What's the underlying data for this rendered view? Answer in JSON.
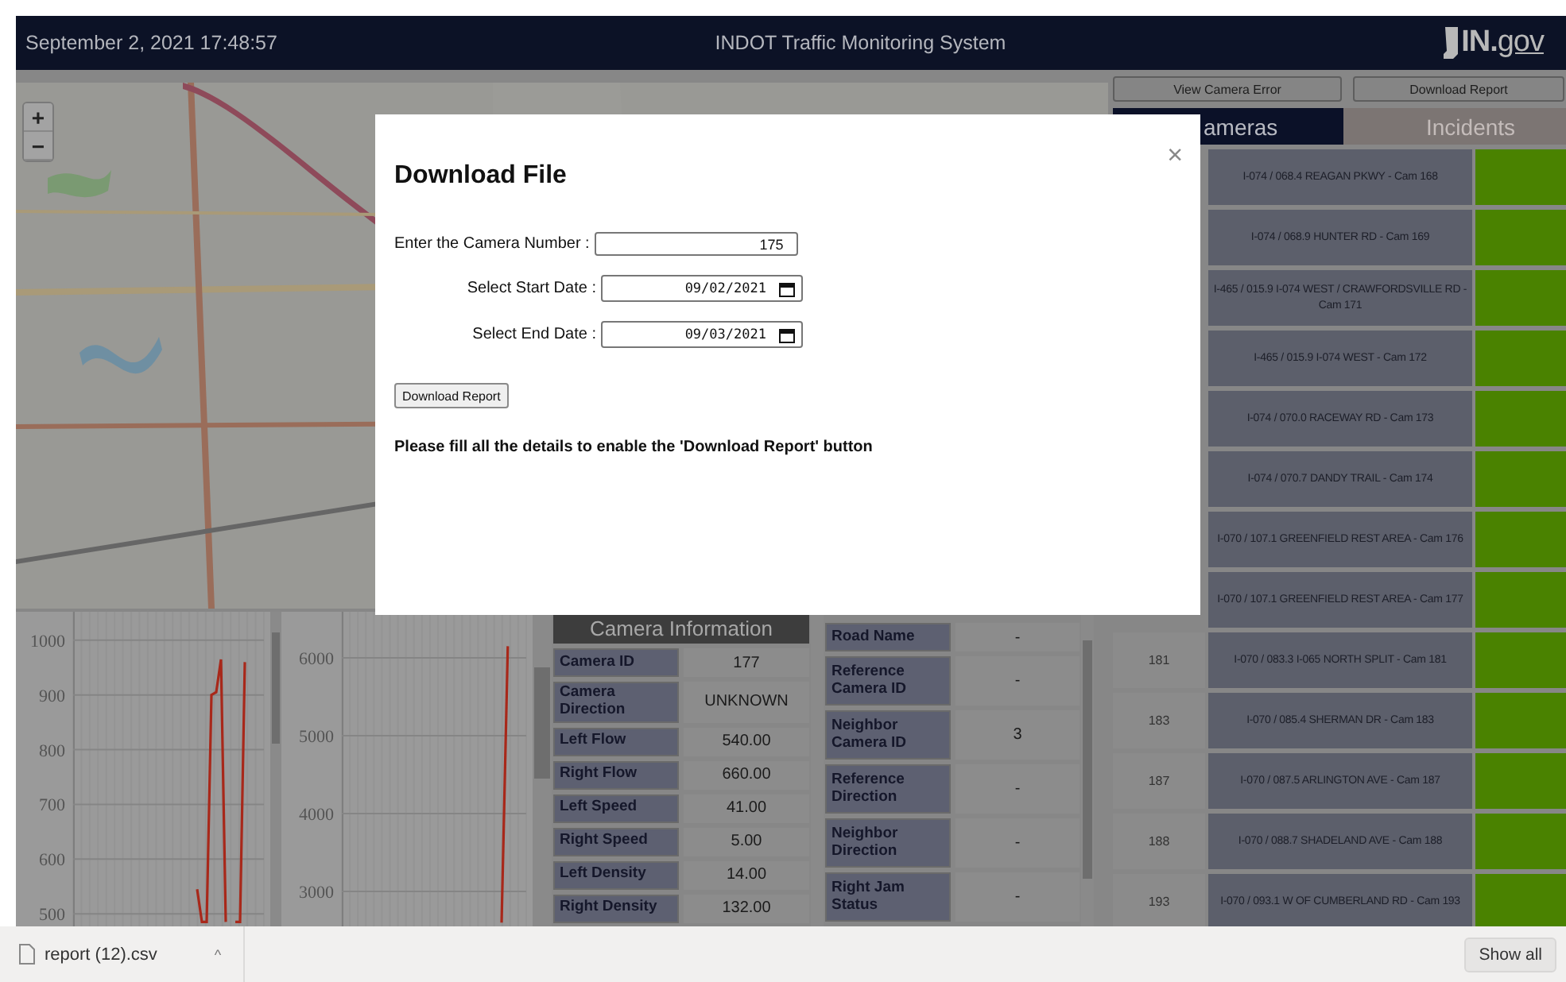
{
  "header": {
    "datetime": "September 2, 2021 17:48:57",
    "title": "INDOT Traffic Monitoring System",
    "logo_prefix": "IN.",
    "logo_domain": "gov"
  },
  "map": {
    "zoom_in": "+",
    "zoom_out": "−"
  },
  "charts": [
    {
      "chart_data": {
        "type": "line",
        "grid": true,
        "ylim": [
          477,
          1052
        ],
        "yticks": [
          500,
          600,
          700,
          800,
          900,
          1000
        ],
        "series": [
          {
            "color": "#a8281a",
            "values": [
              null,
              null,
              null,
              null,
              null,
              null,
              null,
              null,
              null,
              null,
              null,
              null,
              null,
              null,
              null,
              null,
              null,
              null,
              null,
              null,
              null,
              null,
              null,
              null,
              null,
              null,
              545,
              485,
              485,
              900,
              905,
              965,
              485,
              null,
              485,
              485,
              960,
              null,
              null,
              null,
              null
            ]
          }
        ]
      }
    },
    {
      "chart_data": {
        "type": "line",
        "grid": true,
        "ylim": [
          2551,
          6592
        ],
        "yticks": [
          3000,
          4000,
          5000,
          6000
        ],
        "series": [
          {
            "color": "#a8281a",
            "values": [
              null,
              null,
              null,
              null,
              null,
              null,
              null,
              null,
              null,
              null,
              null,
              null,
              null,
              null,
              null,
              null,
              null,
              null,
              null,
              null,
              null,
              null,
              null,
              null,
              null,
              null,
              2600,
              6150,
              null,
              null,
              null
            ]
          }
        ]
      }
    }
  ],
  "camera_info": {
    "title": "Camera Information",
    "rows": [
      {
        "label": "Camera ID",
        "value": "177"
      },
      {
        "label": "Camera Direction",
        "value": "UNKNOWN"
      },
      {
        "label": "Left Flow",
        "value": "540.00"
      },
      {
        "label": "Right Flow",
        "value": "660.00"
      },
      {
        "label": "Left Speed",
        "value": "41.00"
      },
      {
        "label": "Right Speed",
        "value": "5.00"
      },
      {
        "label": "Left Density",
        "value": "14.00"
      },
      {
        "label": "Right Density",
        "value": "132.00"
      }
    ]
  },
  "details": {
    "rows": [
      {
        "label": "Road Name",
        "value": "-"
      },
      {
        "label": "Reference Camera ID",
        "value": "-"
      },
      {
        "label": "Neighbor Camera ID",
        "value": "3"
      },
      {
        "label": "Reference Direction",
        "value": "-"
      },
      {
        "label": "Neighbor Direction",
        "value": "-"
      },
      {
        "label": "Right Jam Status",
        "value": "-"
      }
    ]
  },
  "right_panel": {
    "buttons": [
      "View Camera Error",
      "Download Report"
    ],
    "tabs": [
      {
        "label": "ameras",
        "selected": true
      },
      {
        "label": "Incidents",
        "selected": false
      }
    ],
    "cameras": [
      {
        "name": "I-074 / 068.4 REAGAN PKWY - Cam 168",
        "color": "#4a8200"
      },
      {
        "name": "I-074 / 068.9 HUNTER RD - Cam 169",
        "color": "#4a8200"
      },
      {
        "name": "I-465 / 015.9 I-074 WEST / CRAWFORDSVILLE RD - Cam 171",
        "color": "#4a8200"
      },
      {
        "name": "I-465 / 015.9 I-074 WEST - Cam 172",
        "color": "#4a8200"
      },
      {
        "name": "I-074 / 070.0 RACEWAY RD - Cam 173",
        "color": "#4a8200"
      },
      {
        "name": "I-074 / 070.7 DANDY TRAIL - Cam 174",
        "color": "#4a8200"
      },
      {
        "name": "I-070 / 107.1 GREENFIELD REST AREA - Cam 176",
        "color": "#4a8200"
      },
      {
        "name": "I-070 / 107.1 GREENFIELD REST AREA - Cam 177",
        "color": "#4a8200"
      },
      {
        "number": "181",
        "name": "I-070 / 083.3 I-065 NORTH SPLIT - Cam 181",
        "color": "#4a8200"
      },
      {
        "number": "183",
        "name": "I-070 / 085.4 SHERMAN DR - Cam 183",
        "color": "#4a8200"
      },
      {
        "number": "187",
        "name": "I-070 / 087.5 ARLINGTON AVE - Cam 187",
        "color": "#4a8200"
      },
      {
        "number": "188",
        "name": "I-070 / 088.7 SHADELAND AVE - Cam 188",
        "color": "#4a8200"
      },
      {
        "number": "193",
        "name": "I-070 / 093.1 W OF CUMBERLAND RD - Cam 193",
        "color": "#4a8200"
      }
    ]
  },
  "modal": {
    "title": "Download File",
    "close": "×",
    "fields": [
      {
        "kind": "number",
        "label": "Enter the Camera Number :",
        "value": "175"
      },
      {
        "kind": "date",
        "label": "Select Start Date :",
        "value": "09/02/2021"
      },
      {
        "kind": "date",
        "label": "Select End Date :",
        "value": "09/03/2021"
      }
    ],
    "button": "Download Report",
    "message": "Please fill all the details to enable the 'Download Report' button"
  },
  "download_bar": {
    "file": "report (12).csv",
    "caret": "^",
    "show_all": "Show all"
  }
}
